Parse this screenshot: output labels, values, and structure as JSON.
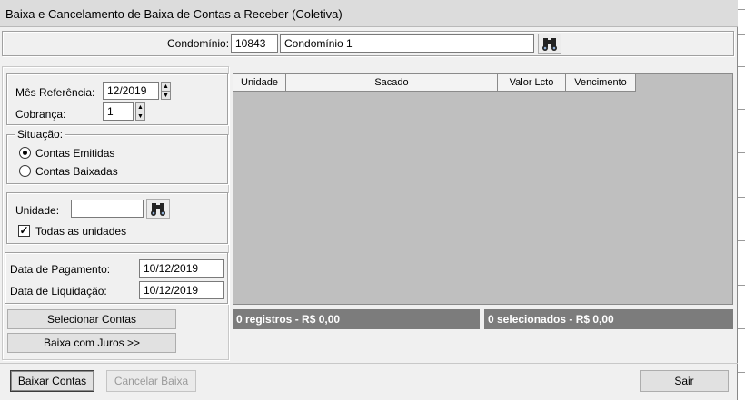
{
  "window": {
    "title": "Baixa e Cancelamento de Baixa de Contas a Receber (Coletiva)"
  },
  "condominio": {
    "label": "Condomínio:",
    "code": "10843",
    "name": "Condomínio 1",
    "search_icon": "binoculars-icon"
  },
  "filters": {
    "mes_referencia_label": "Mês Referência:",
    "mes_referencia_value": "12/2019",
    "cobranca_label": "Cobrança:",
    "cobranca_value": "1"
  },
  "situacao": {
    "caption": "Situação:",
    "options": [
      {
        "label": "Contas Emitidas",
        "selected": true
      },
      {
        "label": "Contas Baixadas",
        "selected": false
      }
    ]
  },
  "unidade": {
    "label": "Unidade:",
    "value": "",
    "search_icon": "binoculars-icon",
    "todas_label": "Todas as unidades",
    "todas_checked": true
  },
  "datas": {
    "pagamento_label": "Data de Pagamento:",
    "pagamento_value": "10/12/2019",
    "liquidacao_label": "Data de Liquidação:",
    "liquidacao_value": "10/12/2019"
  },
  "buttons": {
    "selecionar": "Selecionar Contas",
    "baixa_juros": "Baixa com Juros >>",
    "baixar": "Baixar Contas",
    "cancelar": "Cancelar Baixa",
    "sair": "Sair"
  },
  "grid": {
    "columns": [
      "Unidade",
      "Sacado",
      "Valor Lcto",
      "Vencimento"
    ],
    "rows": []
  },
  "status": {
    "registros": "0 registros - R$ 0,00",
    "selecionados": "0 selecionados - R$ 0,00"
  }
}
